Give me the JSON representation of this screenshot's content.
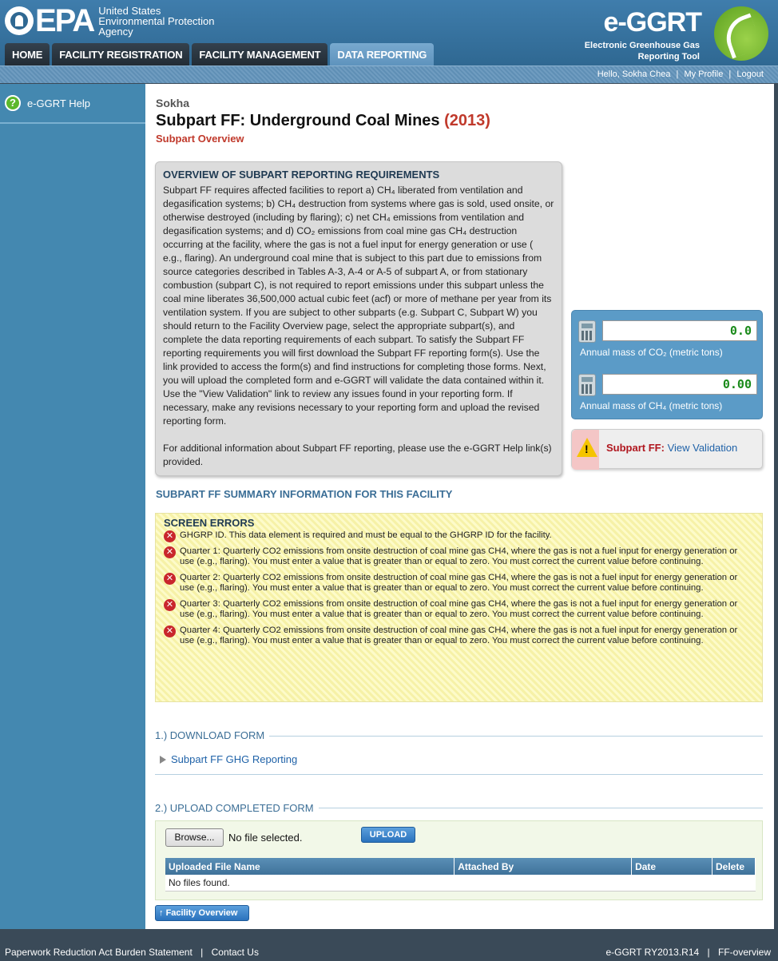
{
  "header": {
    "agency_line1": "United States",
    "agency_line2": "Environmental Protection",
    "agency_line3": "Agency",
    "epa": "EPA",
    "app_title": "e-GGRT",
    "app_sub1": "Electronic Greenhouse Gas",
    "app_sub2": "Reporting Tool"
  },
  "nav": {
    "tabs": [
      {
        "label": "HOME"
      },
      {
        "label": "FACILITY REGISTRATION"
      },
      {
        "label": "FACILITY MANAGEMENT"
      },
      {
        "label": "DATA REPORTING"
      }
    ],
    "active": "DATA REPORTING"
  },
  "userbar": {
    "greeting": "Hello, Sokha Chea",
    "profile": "My Profile",
    "logout": "Logout",
    "sep": "|"
  },
  "sidebar": {
    "help": "e-GGRT Help",
    "help_icon": "?"
  },
  "page": {
    "facility": "Sokha",
    "title": "Subpart FF: Underground Coal Mines",
    "year": "(2013)",
    "subtitle": "Subpart Overview"
  },
  "overview": {
    "title": "OVERVIEW OF SUBPART REPORTING REQUIREMENTS",
    "p1": "Subpart FF requires affected facilities to report a) CH₄ liberated from ventilation and degasification systems; b) CH₄ destruction from systems where gas is sold, used onsite, or otherwise destroyed (including by flaring); c) net CH₄ emissions from ventilation and degasification systems; and d) CO₂ emissions from coal mine gas CH₄ destruction occurring at the facility, where the gas is not a fuel input for energy generation or use ( e.g., flaring). An underground coal mine that is subject to this part due to emissions from source categories described in Tables A-3, A-4 or A-5 of subpart A, or from stationary combustion (subpart C), is not required to report emissions under this subpart unless the coal mine liberates 36,500,000 actual cubic feet (acf) or more of methane per year from its ventilation system. If you are subject to other subparts (e.g. Subpart C, Subpart W) you should return to the Facility Overview page, select the appropriate subpart(s), and complete the data reporting requirements of each subpart. To satisfy the Subpart FF reporting requirements you will first download the Subpart FF reporting form(s). Use the link provided to access the form(s) and find instructions for completing those forms. Next, you will upload the completed form and e-GGRT will validate the data contained within it. Use the \"View Validation\" link to review any issues found in your reporting form. If necessary, make any revisions necessary to your reporting form and upload the revised reporting form.",
    "p2": "For additional information about Subpart FF reporting, please use the e-GGRT Help link(s) provided."
  },
  "totals": {
    "co2_value": "0.0",
    "co2_label": "Annual mass of CO₂ (metric tons)",
    "ch4_value": "0.00",
    "ch4_label": "Annual mass of CH₄ (metric tons)"
  },
  "validation": {
    "label": "Subpart FF:",
    "link": "View Validation",
    "mark": "!"
  },
  "summary_heading": "SUBPART FF SUMMARY INFORMATION FOR THIS FACILITY",
  "errors": {
    "title": "SCREEN ERRORS",
    "icon": "✕",
    "items": [
      "GHGRP ID. This data element is required and must be equal to the GHGRP ID for the facility.",
      "Quarter 1: Quarterly CO2 emissions from onsite destruction of coal mine gas CH4, where the gas is not a fuel input for energy generation or use (e.g., flaring). You must enter a value that is greater than or equal to zero. You must correct the current value before continuing.",
      "Quarter 2: Quarterly CO2 emissions from onsite destruction of coal mine gas CH4, where the gas is not a fuel input for energy generation or use (e.g., flaring). You must enter a value that is greater than or equal to zero. You must correct the current value before continuing.",
      "Quarter 3: Quarterly CO2 emissions from onsite destruction of coal mine gas CH4, where the gas is not a fuel input for energy generation or use (e.g., flaring). You must enter a value that is greater than or equal to zero. You must correct the current value before continuing.",
      "Quarter 4: Quarterly CO2 emissions from onsite destruction of coal mine gas CH4, where the gas is not a fuel input for energy generation or use (e.g., flaring). You must enter a value that is greater than or equal to zero. You must correct the current value before continuing."
    ]
  },
  "download": {
    "title": "1.) DOWNLOAD FORM",
    "link": "Subpart FF GHG Reporting"
  },
  "upload": {
    "title": "2.) UPLOAD COMPLETED FORM",
    "browse": "Browse...",
    "file_status": "No file selected.",
    "upload_btn": "UPLOAD",
    "columns": [
      "Uploaded File Name",
      "Attached By",
      "Date",
      "Delete"
    ],
    "empty": "No files found."
  },
  "facility_overview_btn": "Facility Overview",
  "facility_overview_arrow": "↑",
  "footer": {
    "paperwork": "Paperwork Reduction Act Burden Statement",
    "contact": "Contact Us",
    "version": "e-GGRT RY2013.R14",
    "page_id": "FF-overview",
    "sep": "|"
  }
}
